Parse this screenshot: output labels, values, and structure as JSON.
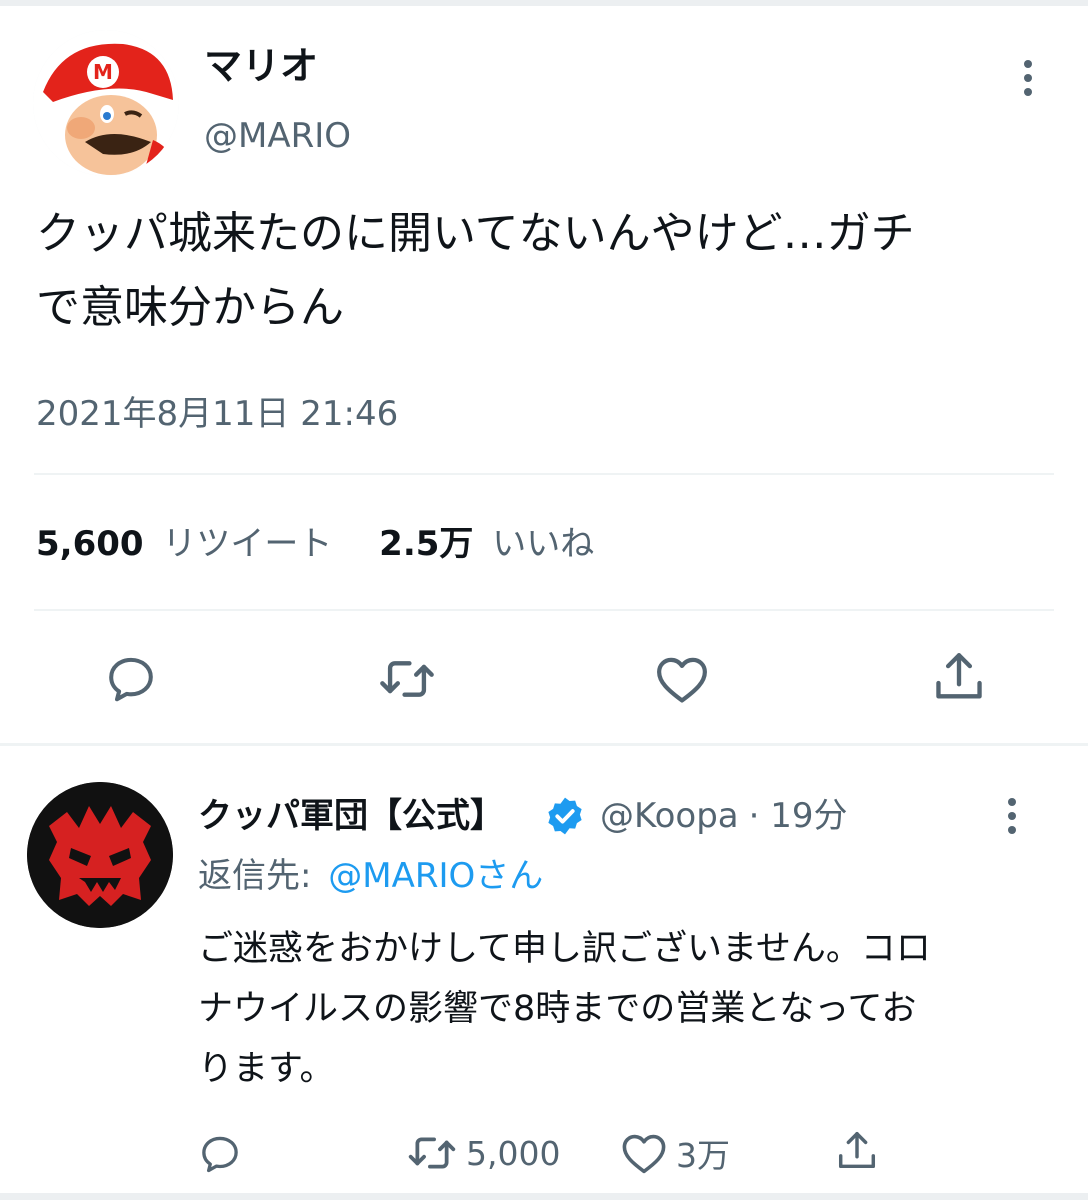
{
  "tweet": {
    "display_name": "マリオ",
    "handle": "@MARIO",
    "text_line1": "クッパ城来たのに開いてないんやけど…ガチ",
    "text_line2": "で意味分からん",
    "timestamp": "2021年8月11日 21:46",
    "retweet_count": "5,600",
    "retweet_label": "リツイート",
    "like_count": "2.5万",
    "like_label": "いいね"
  },
  "reply": {
    "display_name": "クッパ軍団【公式】",
    "handle": "@Koopa",
    "time": "· 19分",
    "reply_to_label": "返信先:",
    "reply_to_handle": "@MARIOさん",
    "text_line1": "ご迷惑をおかけして申し訳ございません。コロ",
    "text_line2": "ナウイルスの影響で8時までの営業となってお",
    "text_line3": "ります。",
    "retweet_count": "5,000",
    "like_count": "3万"
  },
  "icons": [
    "more-icon",
    "reply-icon",
    "retweet-icon",
    "like-icon",
    "share-icon",
    "verified-badge-icon"
  ],
  "colors": {
    "accent": "#1d9bf0",
    "secondary_text": "#536471",
    "mario_red": "#e3231b",
    "koopa_bg": "#111111"
  }
}
